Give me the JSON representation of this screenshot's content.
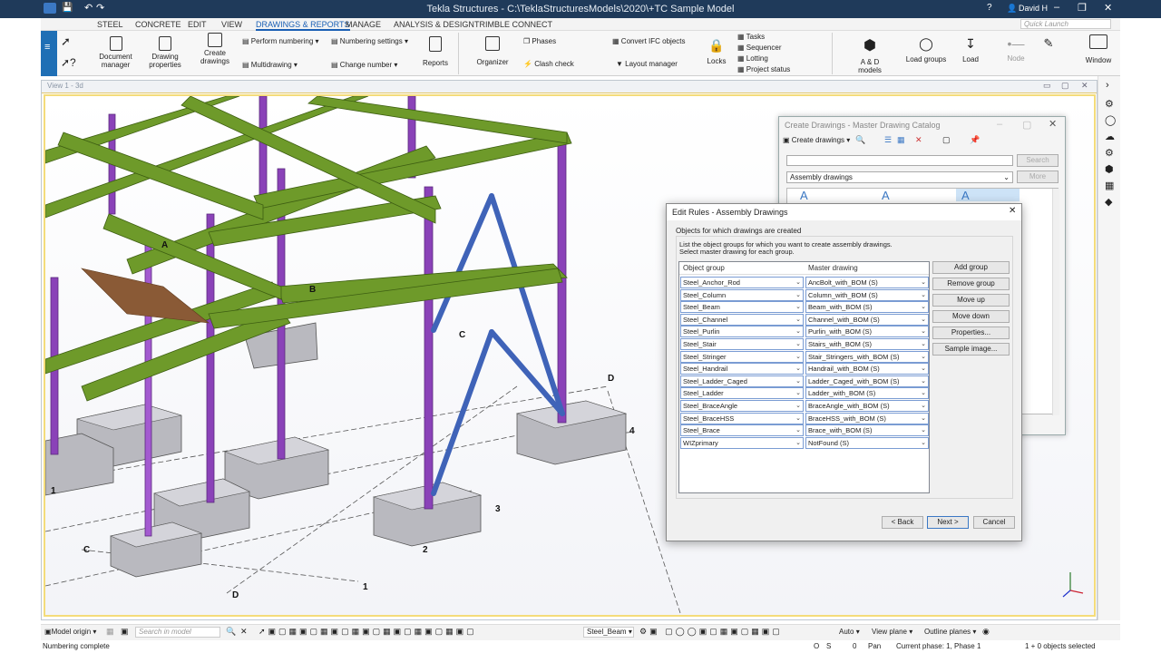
{
  "app": {
    "title": "Tekla Structures - C:\\TeklaStructuresModels\\2020\\+TC Sample Model",
    "user": "David H",
    "quick_launch_placeholder": "Quick Launch"
  },
  "tabs": [
    "STEEL",
    "CONCRETE",
    "EDIT",
    "VIEW",
    "DRAWINGS & REPORTS",
    "MANAGE",
    "ANALYSIS & DESIGN",
    "TRIMBLE CONNECT"
  ],
  "active_tab": "DRAWINGS & REPORTS",
  "ribbon": {
    "document_manager": [
      "Document",
      "manager"
    ],
    "drawing_properties": [
      "Drawing",
      "properties"
    ],
    "create_drawings": [
      "Create",
      "drawings"
    ],
    "perform_numbering": "Perform numbering",
    "numbering_settings": "Numbering settings",
    "multidrawing": "Multidrawing",
    "change_number": "Change number",
    "reports": "Reports",
    "organizer": "Organizer",
    "phases": "Phases",
    "clash_check": "Clash check",
    "convert_ifc": "Convert IFC objects",
    "layout_manager": "Layout manager",
    "locks": "Locks",
    "tasks": "Tasks",
    "sequencer": "Sequencer",
    "lotting": "Lotting",
    "project_status": "Project status",
    "ad_models": "A & D models",
    "load_groups": "Load groups",
    "load": "Load",
    "node": "Node",
    "window": "Window"
  },
  "view": {
    "title": "View 1 - 3d"
  },
  "grid_labels": [
    "A",
    "B",
    "C",
    "D",
    "4",
    "3",
    "2",
    "1",
    "1",
    "C",
    "D"
  ],
  "catalog": {
    "title": "Create Drawings - Master Drawing Catalog",
    "create_drawings": "Create drawings",
    "search_btn": "Search",
    "filter_value": "Assembly drawings",
    "more_btn": "More"
  },
  "dialog": {
    "title": "Edit Rules - Assembly Drawings",
    "section": "Objects for which drawings are created",
    "desc1": "List the object groups for which you want to create assembly drawings.",
    "desc2": "Select master drawing for each group.",
    "col_group": "Object group",
    "col_master": "Master drawing",
    "rows": [
      {
        "group": "Steel_Anchor_Rod",
        "master": "AncBolt_with_BOM (S)"
      },
      {
        "group": "Steel_Column",
        "master": "Column_with_BOM (S)"
      },
      {
        "group": "Steel_Beam",
        "master": "Beam_with_BOM (S)"
      },
      {
        "group": "Steel_Channel",
        "master": "Channel_with_BOM (S)"
      },
      {
        "group": "Steel_Purlin",
        "master": "Purlin_with_BOM (S)"
      },
      {
        "group": "Steel_Stair",
        "master": "Stairs_with_BOM (S)"
      },
      {
        "group": "Steel_Stringer",
        "master": "Stair_Stringers_with_BOM (S)"
      },
      {
        "group": "Steel_Handrail",
        "master": "Handrail_with_BOM (S)"
      },
      {
        "group": "Steel_Ladder_Caged",
        "master": "Ladder_Caged_with_BOM (S)"
      },
      {
        "group": "Steel_Ladder",
        "master": "Ladder_with_BOM (S)"
      },
      {
        "group": "Steel_BraceAngle",
        "master": "BraceAngle_with_BOM (S)"
      },
      {
        "group": "Steel_BraceHSS",
        "master": "BraceHSS_with_BOM (S)"
      },
      {
        "group": "Steel_Brace",
        "master": "Brace_with_BOM (S)"
      },
      {
        "group": "WIZprimary",
        "master": "NotFound (S)"
      }
    ],
    "buttons": {
      "add_group": "Add group",
      "remove_group": "Remove group",
      "move_up": "Move up",
      "move_down": "Move down",
      "properties": "Properties...",
      "sample_image": "Sample image...",
      "back": "< Back",
      "next": "Next >",
      "cancel": "Cancel"
    }
  },
  "statusbar": {
    "model_origin": "Model origin",
    "search_placeholder": "Search in model",
    "class_value": "Steel_Beam",
    "auto": "Auto",
    "view_plane": "View plane",
    "outline_planes": "Outline planes"
  },
  "messages": {
    "left": "Numbering complete",
    "o": "O",
    "s": "S",
    "zero": "0",
    "pan": "Pan",
    "phase": "Current phase: 1, Phase 1",
    "selected": "1 + 0 objects selected"
  },
  "colors": {
    "beam": "#6e9a2a",
    "column": "#8a42b8",
    "brace": "#3f63b8",
    "footing": "#b9b9bf",
    "titlebar": "#1f3a5a"
  }
}
